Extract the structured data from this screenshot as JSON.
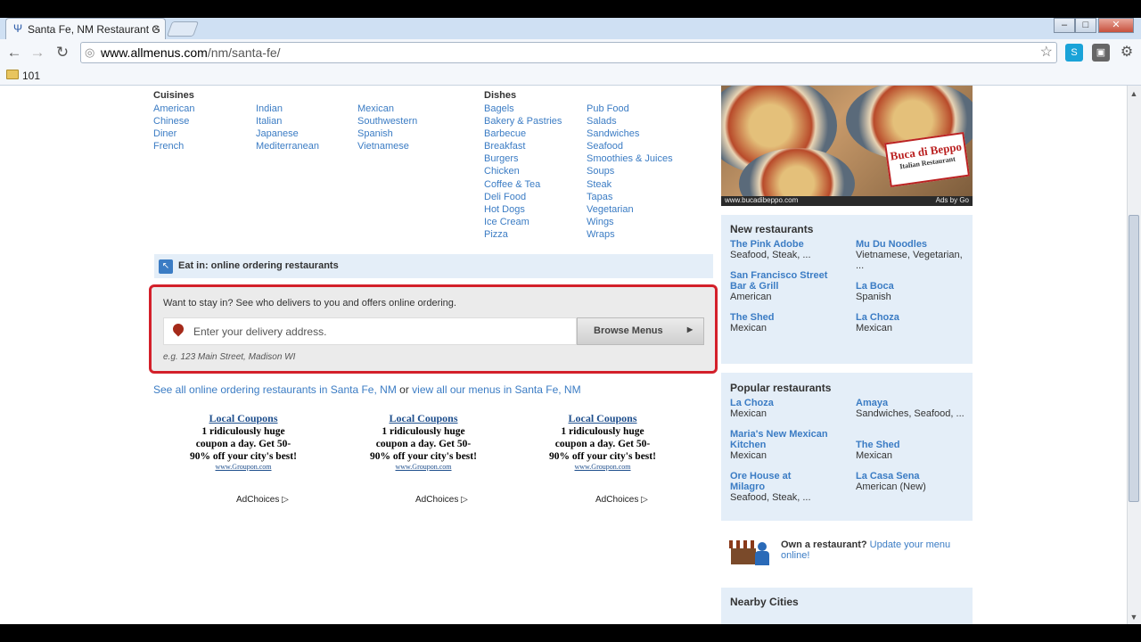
{
  "browser": {
    "tab_title": "Santa Fe, NM Restaurant G",
    "close_glyph": "×",
    "url_host": "www.allmenus.com",
    "url_path": "/nm/santa-fe/",
    "bookmark": "101",
    "min_glyph": "–",
    "max_glyph": "□",
    "close_win_glyph": "✕"
  },
  "cuisines": {
    "heading": "Cuisines",
    "col1": [
      "American",
      "Chinese",
      "Diner",
      "French"
    ],
    "col2": [
      "Indian",
      "Italian",
      "Japanese",
      "Mediterranean"
    ],
    "col3": [
      "Mexican",
      "Southwestern",
      "Spanish",
      "Vietnamese"
    ]
  },
  "dishes": {
    "heading": "Dishes",
    "col1": [
      "Bagels",
      "Bakery & Pastries",
      "Barbecue",
      "Breakfast",
      "Burgers",
      "Chicken",
      "Coffee & Tea",
      "Deli Food",
      "Hot Dogs",
      "Ice Cream",
      "Pizza"
    ],
    "col2": [
      "Pub Food",
      "Salads",
      "Sandwiches",
      "Seafood",
      "Smoothies & Juices",
      "Soups",
      "Steak",
      "Tapas",
      "Vegetarian",
      "Wings",
      "Wraps"
    ]
  },
  "eat_in": {
    "title": "Eat in: online ordering restaurants",
    "question": "Want to stay in? See who delivers to you and offers online ordering.",
    "address_placeholder": "Enter your delivery address.",
    "browse_label": "Browse Menus",
    "example": "e.g. 123 Main Street, Madison WI"
  },
  "see_all": {
    "link1": "See all online ordering restaurants in Santa Fe, NM",
    "or": " or ",
    "link2": "view all our menus in Santa Fe, NM"
  },
  "ads": [
    {
      "title": "Local Coupons",
      "body": "1 ridiculously huge coupon a day. Get 50-90% off your city's best!",
      "url": "www.Groupon.com",
      "choices": "AdChoices"
    },
    {
      "title": "Local Coupons",
      "body": "1 ridiculously huge coupon a day. Get 50-90% off your city's best!",
      "url": "www.Groupon.com",
      "choices": "AdChoices"
    },
    {
      "title": "Local Coupons",
      "body": "1 ridiculously huge coupon a day. Get 50-90% off your city's best!",
      "url": "www.Groupon.com",
      "choices": "AdChoices"
    }
  ],
  "sidebar_ad": {
    "url": "www.bucadibeppo.com",
    "ads_by": "Ads by Go",
    "brand": "Buca di Beppo",
    "brand_sub": "Italian Restaurant"
  },
  "new_restaurants": {
    "heading": "New restaurants",
    "items": [
      {
        "name": "The Pink Adobe",
        "cat": "Seafood, Steak, ..."
      },
      {
        "name": "Mu Du Noodles",
        "cat": "Vietnamese, Vegetarian, ..."
      },
      {
        "name": "San Francisco Street Bar & Grill",
        "cat": "American"
      },
      {
        "name": "La Boca",
        "cat": "Spanish"
      },
      {
        "name": "The Shed",
        "cat": "Mexican"
      },
      {
        "name": "La Choza",
        "cat": "Mexican"
      }
    ]
  },
  "popular_restaurants": {
    "heading": "Popular restaurants",
    "items": [
      {
        "name": "La Choza",
        "cat": "Mexican"
      },
      {
        "name": "Amaya",
        "cat": "Sandwiches, Seafood, ..."
      },
      {
        "name": "Maria's New Mexican Kitchen",
        "cat": "Mexican"
      },
      {
        "name": "The Shed",
        "cat": "Mexican"
      },
      {
        "name": "Ore House at Milagro",
        "cat": "Seafood, Steak, ..."
      },
      {
        "name": "La Casa Sena",
        "cat": "American (New)"
      }
    ]
  },
  "own": {
    "bold": "Own a restaurant?",
    "link": " Update your menu online!"
  },
  "nearby": {
    "heading": "Nearby Cities"
  }
}
